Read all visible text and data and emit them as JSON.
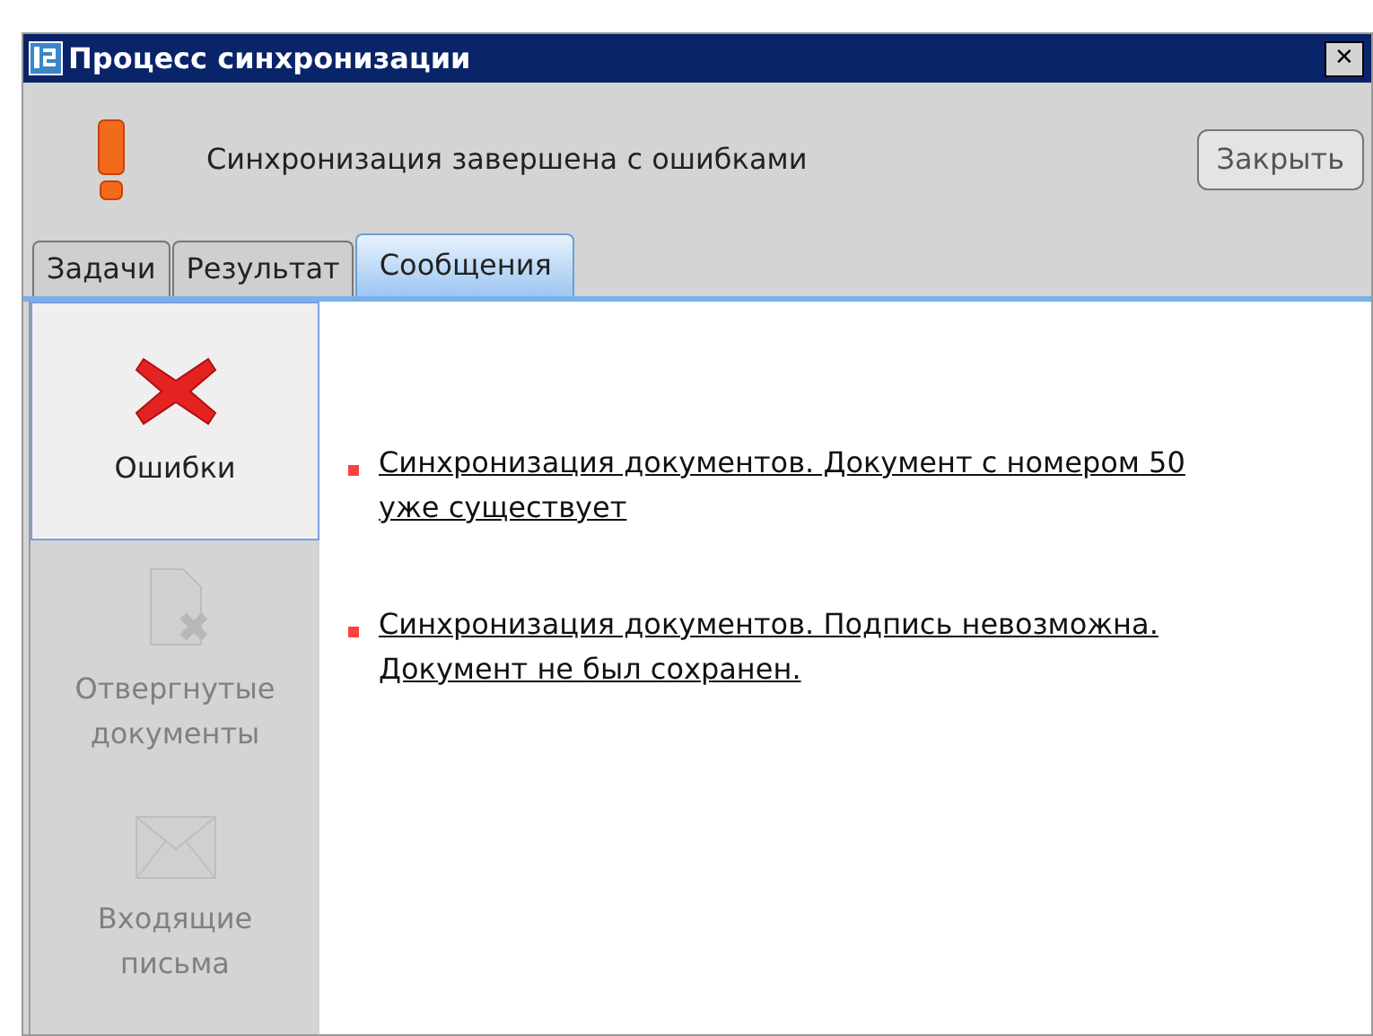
{
  "window": {
    "title": "Процесс синхронизации",
    "close": "✕"
  },
  "header": {
    "message": "Синхронизация завершена с ошибками",
    "close_button": "Закрыть"
  },
  "tabs": [
    {
      "label": "Задачи",
      "selected": false
    },
    {
      "label": "Результат",
      "selected": false
    },
    {
      "label": "Сообщения",
      "selected": true
    }
  ],
  "sidebar": {
    "items": [
      {
        "kind": "errors",
        "label": "Ошибки",
        "selected": true,
        "disabled": false
      },
      {
        "kind": "rejected",
        "label": "Отвергнутые документы",
        "selected": false,
        "disabled": true
      },
      {
        "kind": "incoming",
        "label": "Входящие письма",
        "selected": false,
        "disabled": true
      }
    ]
  },
  "messages": [
    {
      "text": "Синхронизация документов. Документ с номером 50 уже существует",
      "color": "#ff4040"
    },
    {
      "text": "Синхронизация документов. Подпись невозможна. Документ не был сохранен.",
      "color": "#ff4040"
    }
  ]
}
